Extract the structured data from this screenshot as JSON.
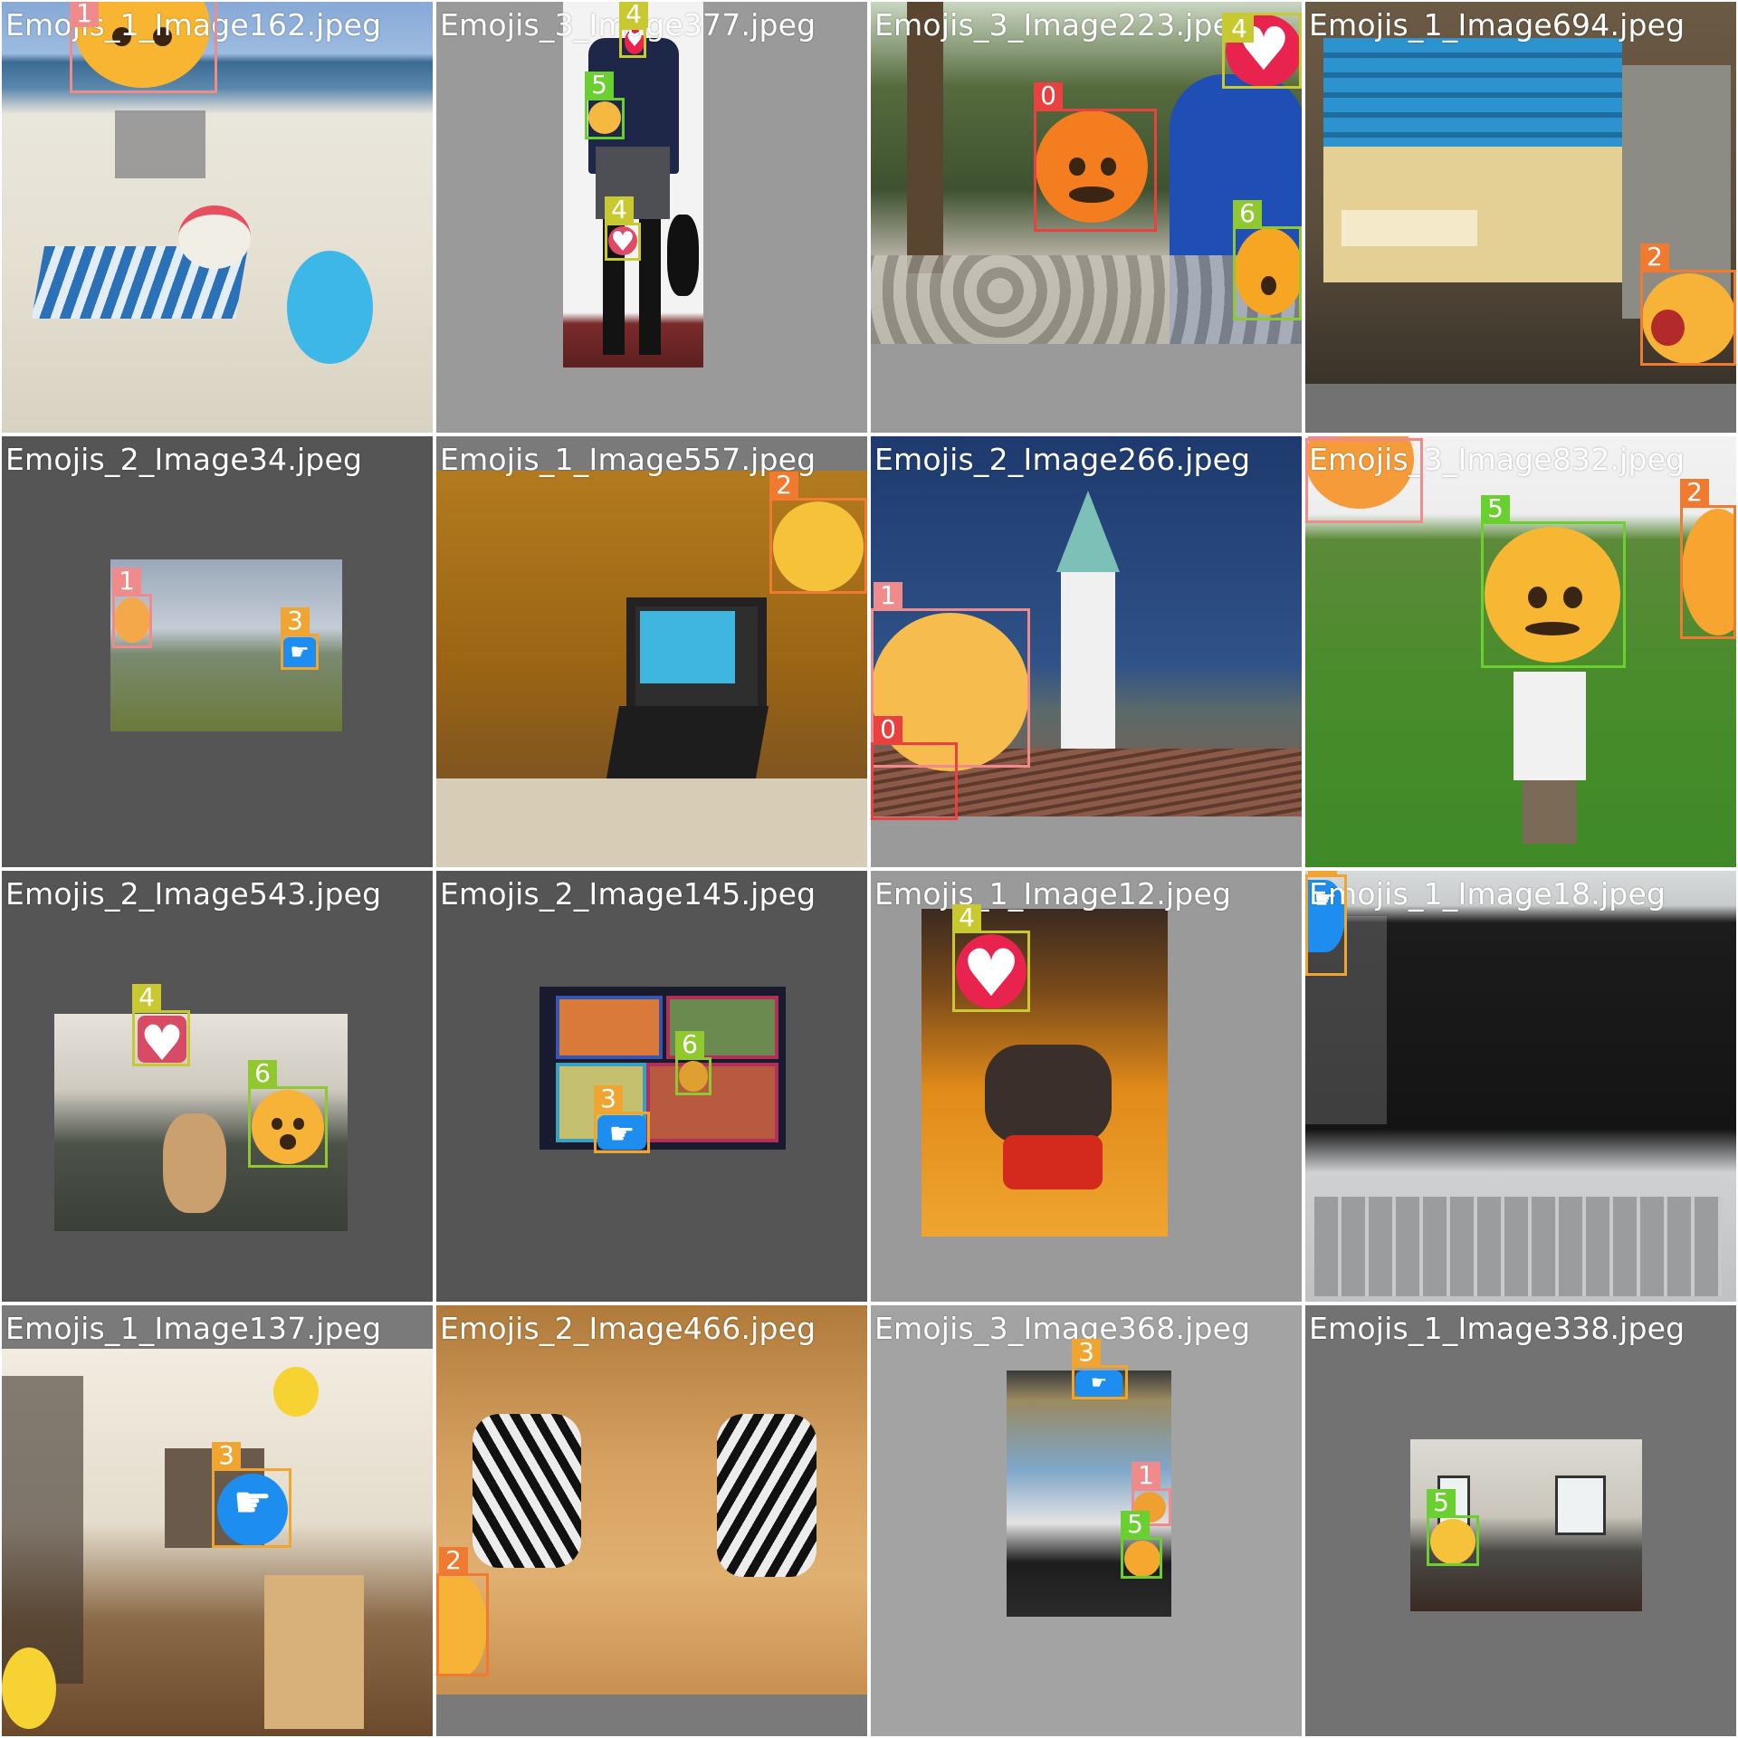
{
  "grid": {
    "tiles": [
      {
        "filename": "Emojis_1_Image162.jpeg"
      },
      {
        "filename": "Emojis_3_Image377.jpeg"
      },
      {
        "filename": "Emojis_3_Image223.jpeg"
      },
      {
        "filename": "Emojis_1_Image694.jpeg"
      },
      {
        "filename": "Emojis_2_Image34.jpeg"
      },
      {
        "filename": "Emojis_1_Image557.jpeg"
      },
      {
        "filename": "Emojis_2_Image266.jpeg"
      },
      {
        "filename": "Emojis_3_Image832.jpeg"
      },
      {
        "filename": "Emojis_2_Image543.jpeg"
      },
      {
        "filename": "Emojis_2_Image145.jpeg"
      },
      {
        "filename": "Emojis_1_Image12.jpeg"
      },
      {
        "filename": "Emojis_1_Image18.jpeg"
      },
      {
        "filename": "Emojis_1_Image137.jpeg"
      },
      {
        "filename": "Emojis_2_Image466.jpeg"
      },
      {
        "filename": "Emojis_3_Image368.jpeg"
      },
      {
        "filename": "Emojis_1_Image338.jpeg"
      }
    ]
  },
  "class_colors": {
    "0": "#e8413f",
    "1": "#f08b8b",
    "2": "#f07a30",
    "3": "#f0a530",
    "4": "#c8c830",
    "5": "#6ad030",
    "6": "#90c830"
  },
  "labels": {
    "c0": "0",
    "c1": "1",
    "c2": "2",
    "c3": "3",
    "c4": "4",
    "c5": "5",
    "c6": "6"
  }
}
